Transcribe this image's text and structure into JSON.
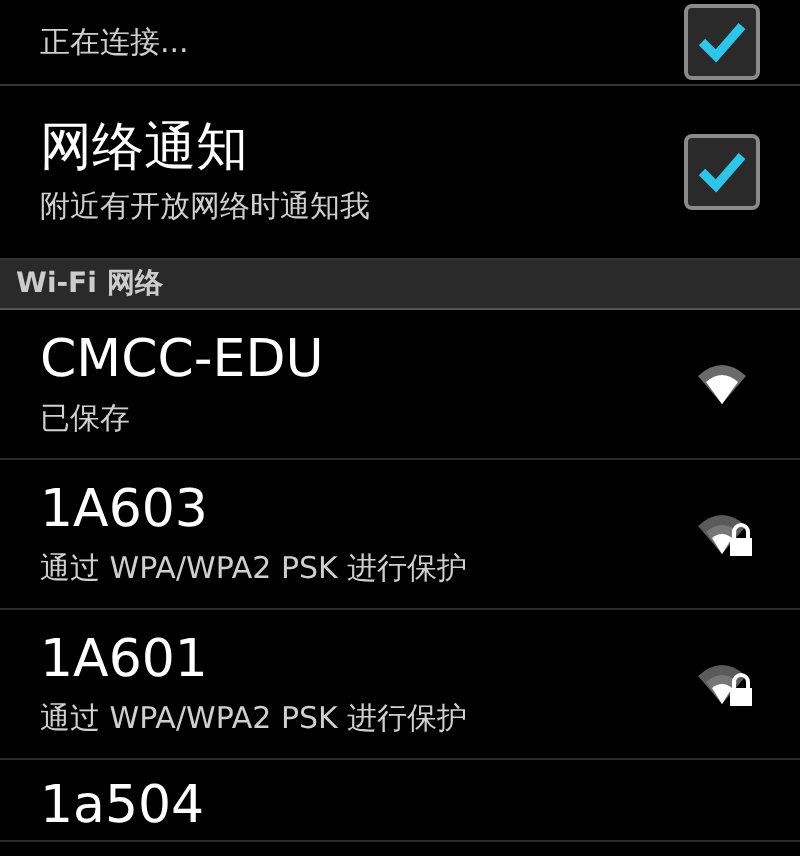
{
  "settings": [
    {
      "subtitle": "正在连接...",
      "checked": true
    },
    {
      "title": "网络通知",
      "subtitle": "附近有开放网络时通知我",
      "checked": true
    }
  ],
  "section": {
    "title": "Wi-Fi 网络"
  },
  "networks": [
    {
      "name": "CMCC-EDU",
      "status": "已保存",
      "secured": false
    },
    {
      "name": "1A603",
      "status": "通过 WPA/WPA2 PSK 进行保护",
      "secured": true
    },
    {
      "name": "1A601",
      "status": "通过 WPA/WPA2 PSK 进行保护",
      "secured": true
    },
    {
      "name": "1a504"
    }
  ]
}
